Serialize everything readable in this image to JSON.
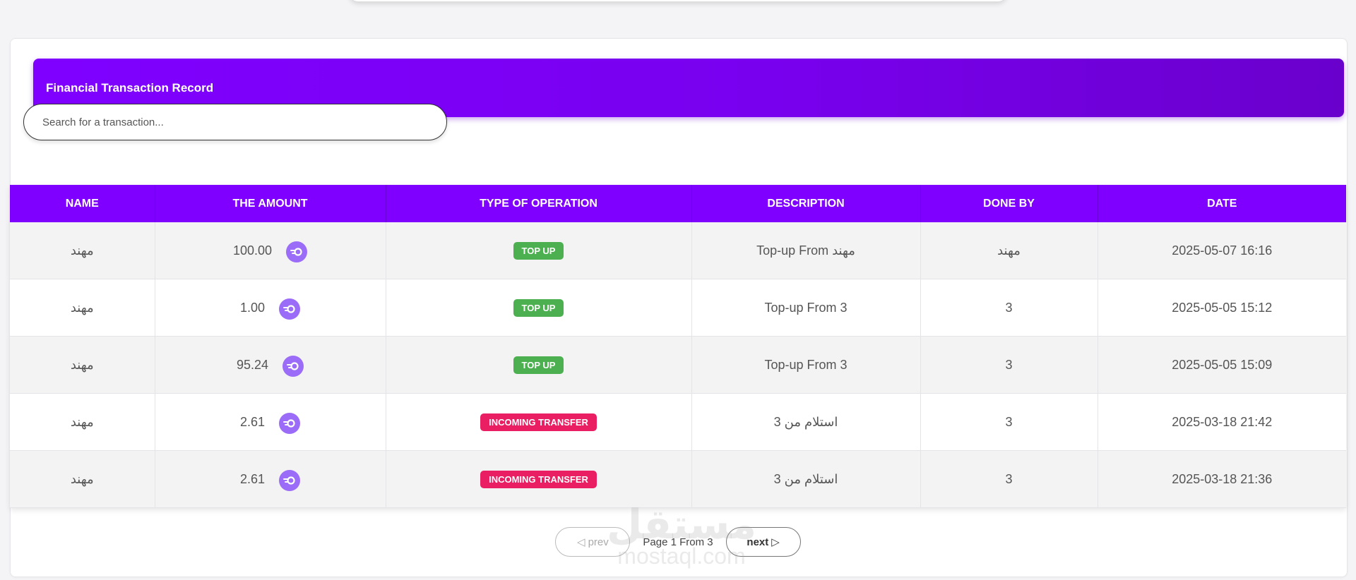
{
  "header": {
    "title": "Financial Transaction Record"
  },
  "search": {
    "placeholder": "Search for a transaction..."
  },
  "table": {
    "columns": [
      "NAME",
      "THE AMOUNT",
      "TYPE OF OPERATION",
      "DESCRIPTION",
      "DONE BY",
      "DATE"
    ],
    "rows": [
      {
        "name": "مهند",
        "amount": "100.00",
        "type": "TOP UP",
        "description": "Top-up From مهند",
        "done_by": "مهند",
        "date": "2025-05-07 16:16"
      },
      {
        "name": "مهند",
        "amount": "1.00",
        "type": "TOP UP",
        "description": "Top-up From 3",
        "done_by": "3",
        "date": "2025-05-05 15:12"
      },
      {
        "name": "مهند",
        "amount": "95.24",
        "type": "TOP UP",
        "description": "Top-up From 3",
        "done_by": "3",
        "date": "2025-05-05 15:09"
      },
      {
        "name": "مهند",
        "amount": "2.61",
        "type": "INCOMING TRANSFER",
        "description": "استلام من 3",
        "done_by": "3",
        "date": "2025-03-18 21:42"
      },
      {
        "name": "مهند",
        "amount": "2.61",
        "type": "INCOMING TRANSFER",
        "description": "استلام من 3",
        "done_by": "3",
        "date": "2025-03-18 21:36"
      }
    ]
  },
  "pagination": {
    "prev_label": "prev",
    "next_label": "next",
    "page_info": "Page 1 From 3"
  },
  "watermark": {
    "arabic": "مستقل",
    "latin": "mostaql.com"
  },
  "colors": {
    "accent": "#7f00ff",
    "topup": "#4caf50",
    "incoming": "#e91e63",
    "coin": "#9b6cf7"
  },
  "icons": {
    "coin": "coin-icon",
    "prev": "triangle-left-icon",
    "next": "triangle-right-icon"
  }
}
